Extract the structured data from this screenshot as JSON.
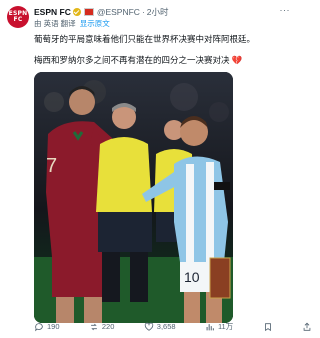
{
  "author": {
    "name": "ESPN FC",
    "handle": "@ESPNFC",
    "time": "2小时",
    "avatar_text": [
      "ESPN",
      "FC"
    ]
  },
  "translate": {
    "prefix": "由 英语 翻译",
    "show_original": "显示原文"
  },
  "tweet": {
    "line1": "葡萄牙的平局意味着他们只能在世界杯决赛中对阵阿根廷。",
    "line2": "梅西和罗纳尔多之间不再有潜在的四分之一决赛对决",
    "heart": "💔"
  },
  "media": {
    "description": "Ronaldo, referee and Messi shaking hands on the pitch before a match",
    "shirt_numbers": [
      "7",
      "10"
    ]
  },
  "stats": {
    "replies": "190",
    "reposts": "220",
    "likes": "3,658",
    "views": "11万"
  },
  "colors": {
    "accent": "#1d9bf0",
    "text": "#0f1419",
    "muted": "#536471",
    "portugal_red": "#8b1a2b",
    "referee_yellow": "#e8e03a",
    "argentina_blue": "#8ec5e6"
  }
}
